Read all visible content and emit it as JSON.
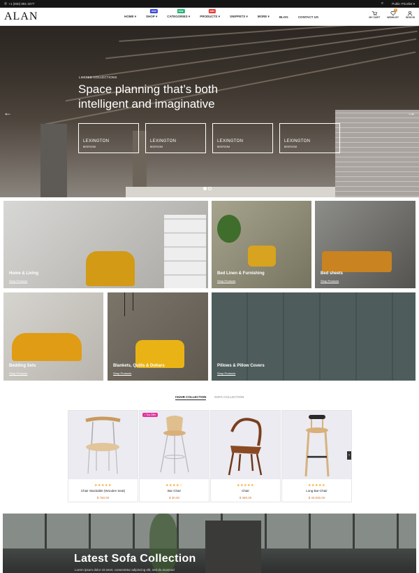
{
  "topbar": {
    "phone": "+1 (930) 891-3277",
    "store": "Public Pricelist"
  },
  "header": {
    "logo": "ALAN"
  },
  "nav": [
    {
      "label": "HOME",
      "caret": "▾"
    },
    {
      "label": "SHOP",
      "caret": "▾",
      "badge": "new",
      "badge_color": "#3b4bd8"
    },
    {
      "label": "CATEGORIES",
      "caret": "▾",
      "badge": "new",
      "badge_color": "#22b573"
    },
    {
      "label": "PRODUCTS",
      "caret": "▾",
      "badge": "sale",
      "badge_color": "#e53935"
    },
    {
      "label": "SNIPPETS",
      "caret": "▾"
    },
    {
      "label": "MORE",
      "caret": "▾"
    },
    {
      "label": "BLOG",
      "caret": ""
    },
    {
      "label": "CONTACT US",
      "caret": ""
    }
  ],
  "header_icons": {
    "cart": "MY CART",
    "wishlist": "WISHLIST",
    "wishlist_count": "0",
    "signin": "SIGN IN"
  },
  "hero": {
    "eyebrow": "LIMITED COLLECTIONS",
    "title": "Space planning that’s both intelligent and imaginative",
    "boxes": [
      {
        "title": "LEXINGTON",
        "sub": "BEDROOM"
      },
      {
        "title": "LEXINGTON",
        "sub": "BEDROOM"
      },
      {
        "title": "LEXINGTON",
        "sub": "BEDROOM"
      },
      {
        "title": "LEXINGTON",
        "sub": "BEDROOM"
      }
    ],
    "prev_icon": "←",
    "next_icon": "→"
  },
  "categories": [
    {
      "title": "Home & Living",
      "link": "Shop Products"
    },
    {
      "title": "Bed Linen & Furnishing",
      "link": "Shop Products"
    },
    {
      "title": "Bed sheets",
      "link": "Shop Products"
    },
    {
      "title": "Bedding Sets",
      "link": "Shop Products"
    },
    {
      "title": "Blankets, Quilts & Dohars",
      "link": "Shop Products"
    },
    {
      "title": "Pillows & Pillow Covers",
      "link": "Shop Products"
    }
  ],
  "collection_tabs": {
    "chair": "CHAIR COLLECTION",
    "sofa": "SOFA COLLECTION"
  },
  "products": [
    {
      "name": "Chair Stackable (Wooden Seat)",
      "price": "$ 750.00",
      "rating": 5,
      "stars": "★★★★★"
    },
    {
      "name": "Bar Chair",
      "price": "$ 30.00",
      "rating": 4,
      "stars": "★★★★☆",
      "tag": "• Top Offer"
    },
    {
      "name": "Chair",
      "price": "$ 390.00",
      "rating": 5,
      "stars": "★★★★★"
    },
    {
      "name": "Long Bar-Chair",
      "price": "$ 40,000.00",
      "rating": 5,
      "stars": "★★★★★"
    }
  ],
  "carousel": {
    "prev": "‹",
    "next": "›"
  },
  "banner": {
    "title": "Latest Sofa Collection",
    "text": "Lorem ipsum dolor sit amet, consectetur adipiscing elit, sed do eiusmod"
  }
}
